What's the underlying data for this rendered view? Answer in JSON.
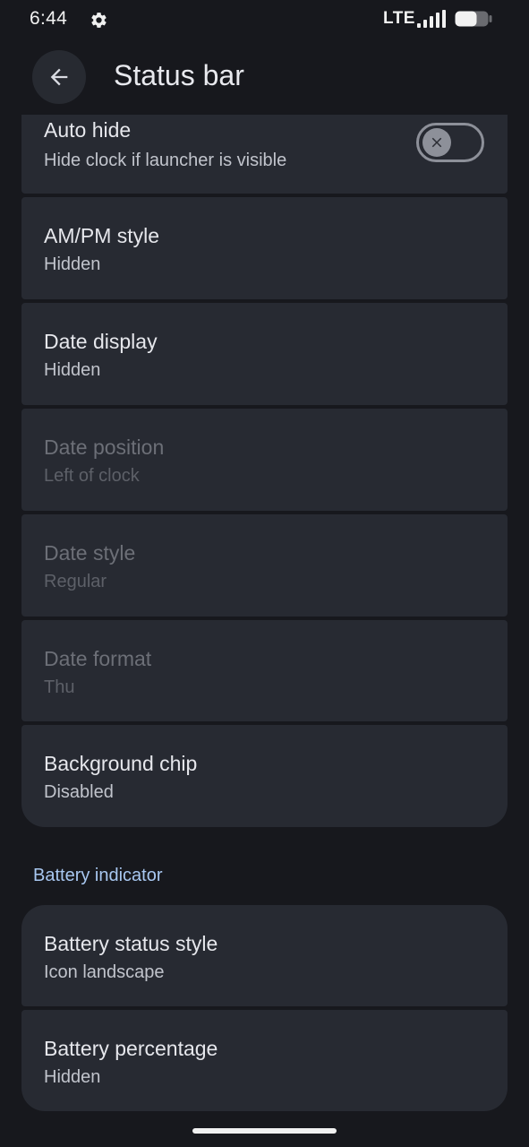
{
  "status_bar": {
    "time": "6:44",
    "network": "LTE",
    "settings_icon": "gear-icon",
    "signal_icon": "signal-icon",
    "battery_icon": "battery-icon"
  },
  "app_bar": {
    "title": "Status bar",
    "back_icon": "arrow-back-icon"
  },
  "items": {
    "auto_hide": {
      "title": "Auto hide",
      "subtitle": "Hide clock if launcher is visible",
      "toggle": "off"
    },
    "ampm": {
      "title": "AM/PM style",
      "subtitle": "Hidden"
    },
    "date_display": {
      "title": "Date display",
      "subtitle": "Hidden"
    },
    "date_position": {
      "title": "Date position",
      "subtitle": "Left of clock"
    },
    "date_style": {
      "title": "Date style",
      "subtitle": "Regular"
    },
    "date_format": {
      "title": "Date format",
      "subtitle": "Thu"
    },
    "background_chip": {
      "title": "Background chip",
      "subtitle": "Disabled"
    }
  },
  "battery_section": {
    "header": "Battery indicator",
    "status_style": {
      "title": "Battery status style",
      "subtitle": "Icon landscape"
    },
    "percentage": {
      "title": "Battery percentage",
      "subtitle": "Hidden"
    }
  },
  "colors": {
    "background": "#17181d",
    "card": "#272a32",
    "accent": "#a8c7f0"
  }
}
